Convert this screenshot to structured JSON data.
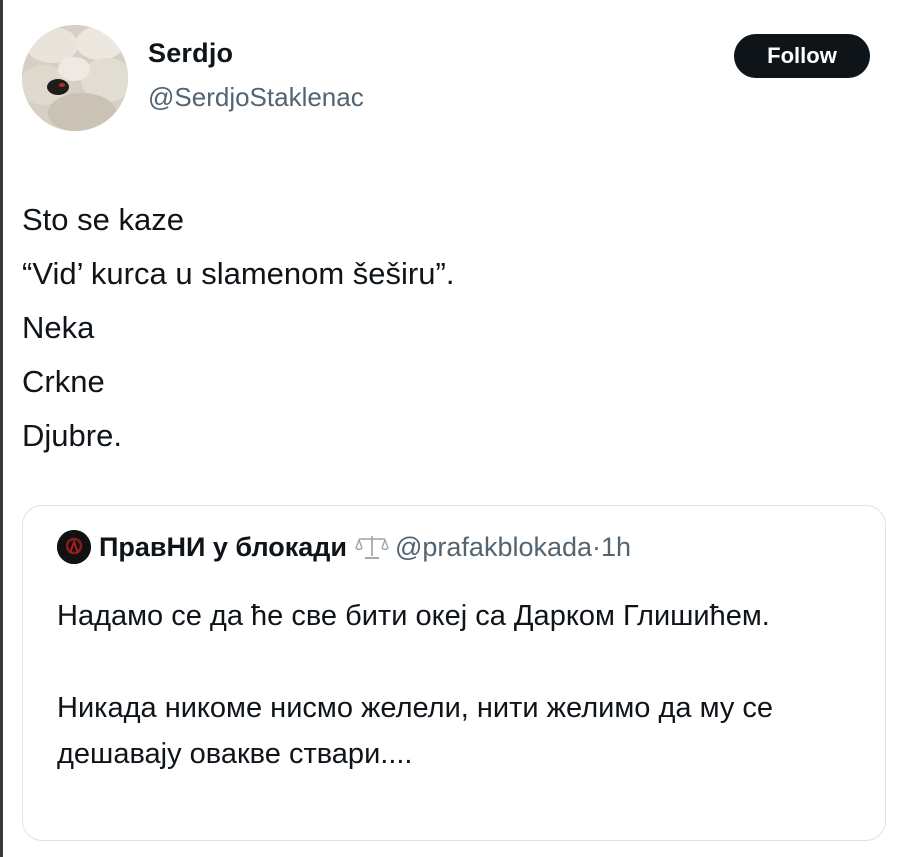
{
  "author": {
    "display_name": "Serdjo",
    "handle": "@SerdjoStaklenac"
  },
  "follow_button": {
    "label": "Follow"
  },
  "tweet": {
    "lines": [
      "Sto se kaze",
      "“Vid’ kurca u slamenom šeširu”.",
      "Neka",
      "Crkne",
      "Djubre."
    ]
  },
  "quoted_tweet": {
    "display_name": "ПравНИ у блокади",
    "name_icon": "scales-icon",
    "handle": "@prafakblokada",
    "separator": "·",
    "time": "1h",
    "paragraphs": [
      "Надамо се да ће све бити океј са Дарком Глишићем.",
      "Никада никоме нисмо желели, нити желимо да му се дешавају овакве ствари...."
    ]
  },
  "colors": {
    "text": "#0f1419",
    "muted": "#536471",
    "follow_bg": "#0f1419",
    "card_border": "#dfe3e6"
  }
}
